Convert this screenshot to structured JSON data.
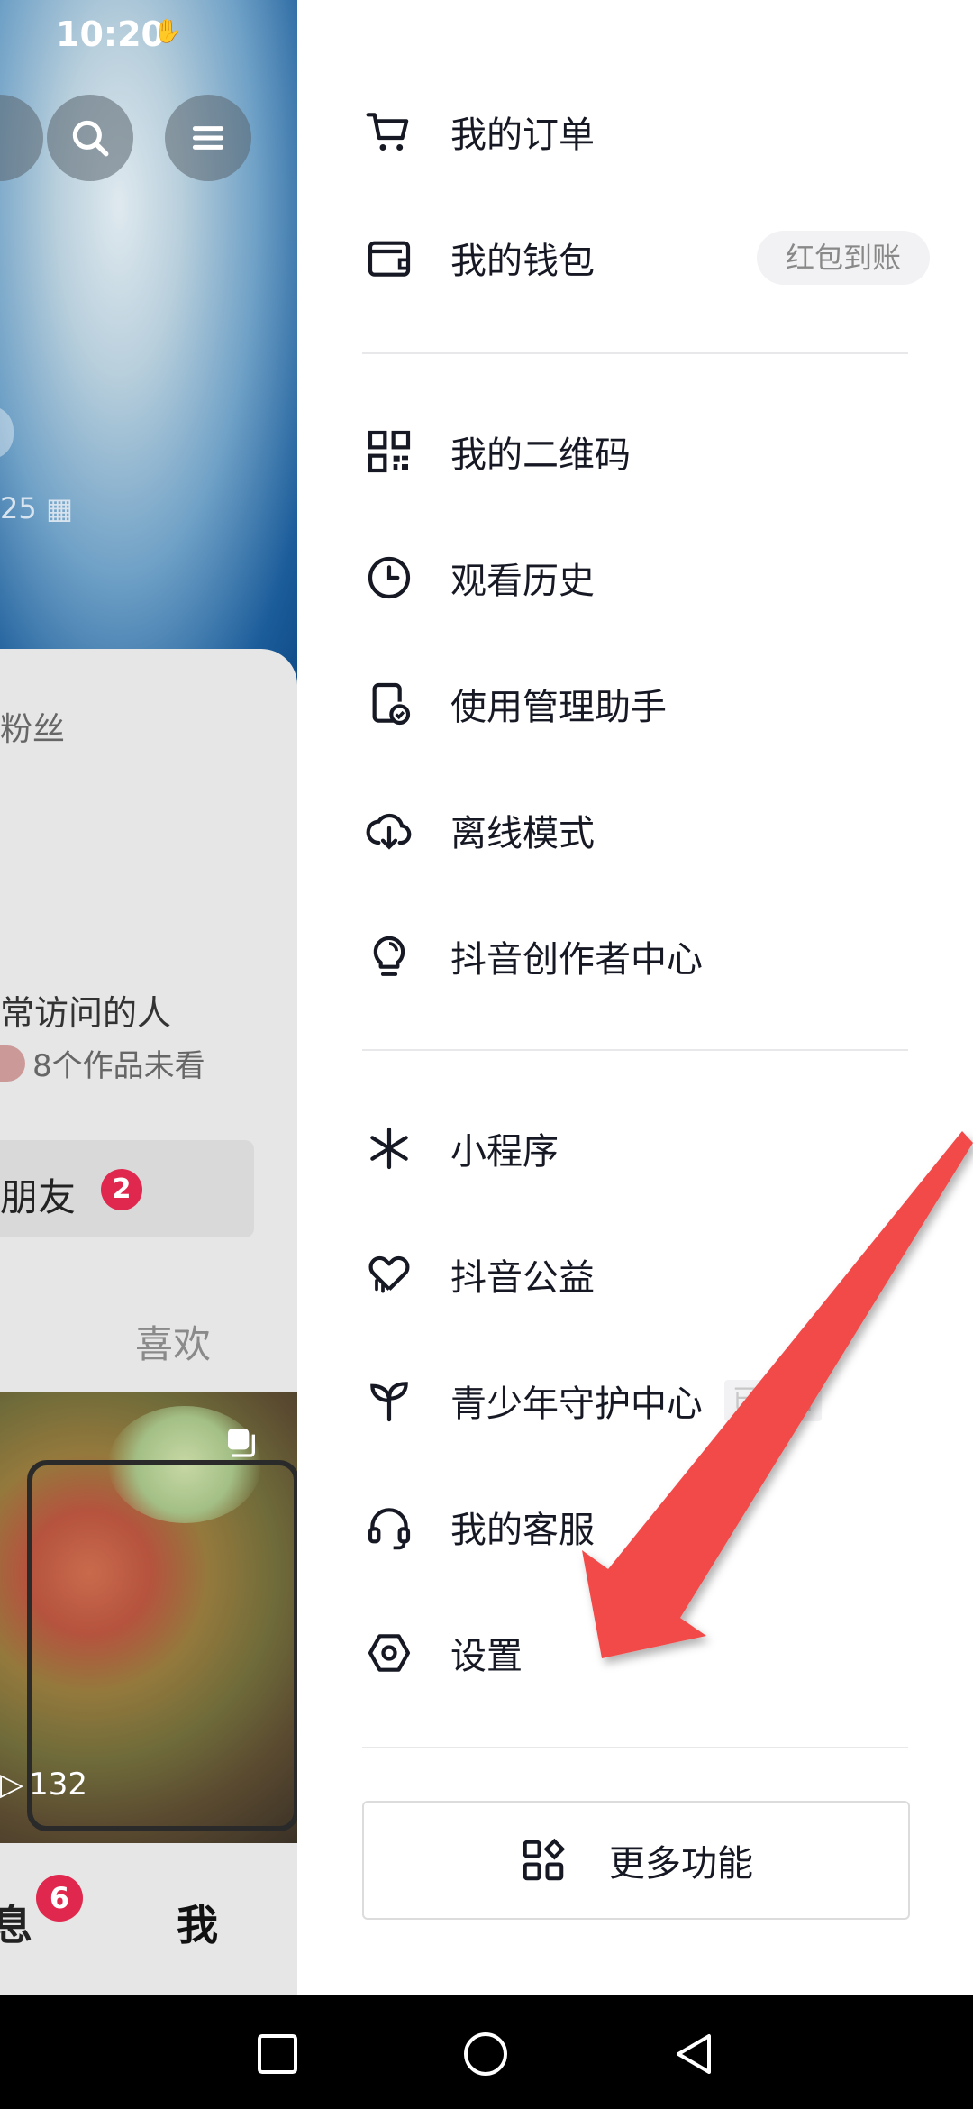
{
  "status": {
    "time": "10:20"
  },
  "background": {
    "fans_label": "粉丝",
    "partial_number": "25",
    "visitor_label": "常访问的人",
    "visitor_sub": "8个作品未看",
    "friends_label": "朋友",
    "friends_badge": "2",
    "likes_tab": "喜欢",
    "views_count": "132",
    "nav_message": "消息",
    "nav_message_badge": "6",
    "nav_me": "我"
  },
  "menu": {
    "orders": "我的订单",
    "wallet": "我的钱包",
    "wallet_badge": "红包到账",
    "qrcode": "我的二维码",
    "history": "观看历史",
    "usage": "使用管理助手",
    "offline": "离线模式",
    "creator": "抖音创作者中心",
    "miniapp": "小程序",
    "charity": "抖音公益",
    "youth": "青少年守护中心",
    "youth_tag": "已开启",
    "service": "我的客服",
    "settings": "设置",
    "more": "更多功能"
  },
  "colors": {
    "accent_red": "#e0284e",
    "arrow": "#f24a4a"
  }
}
